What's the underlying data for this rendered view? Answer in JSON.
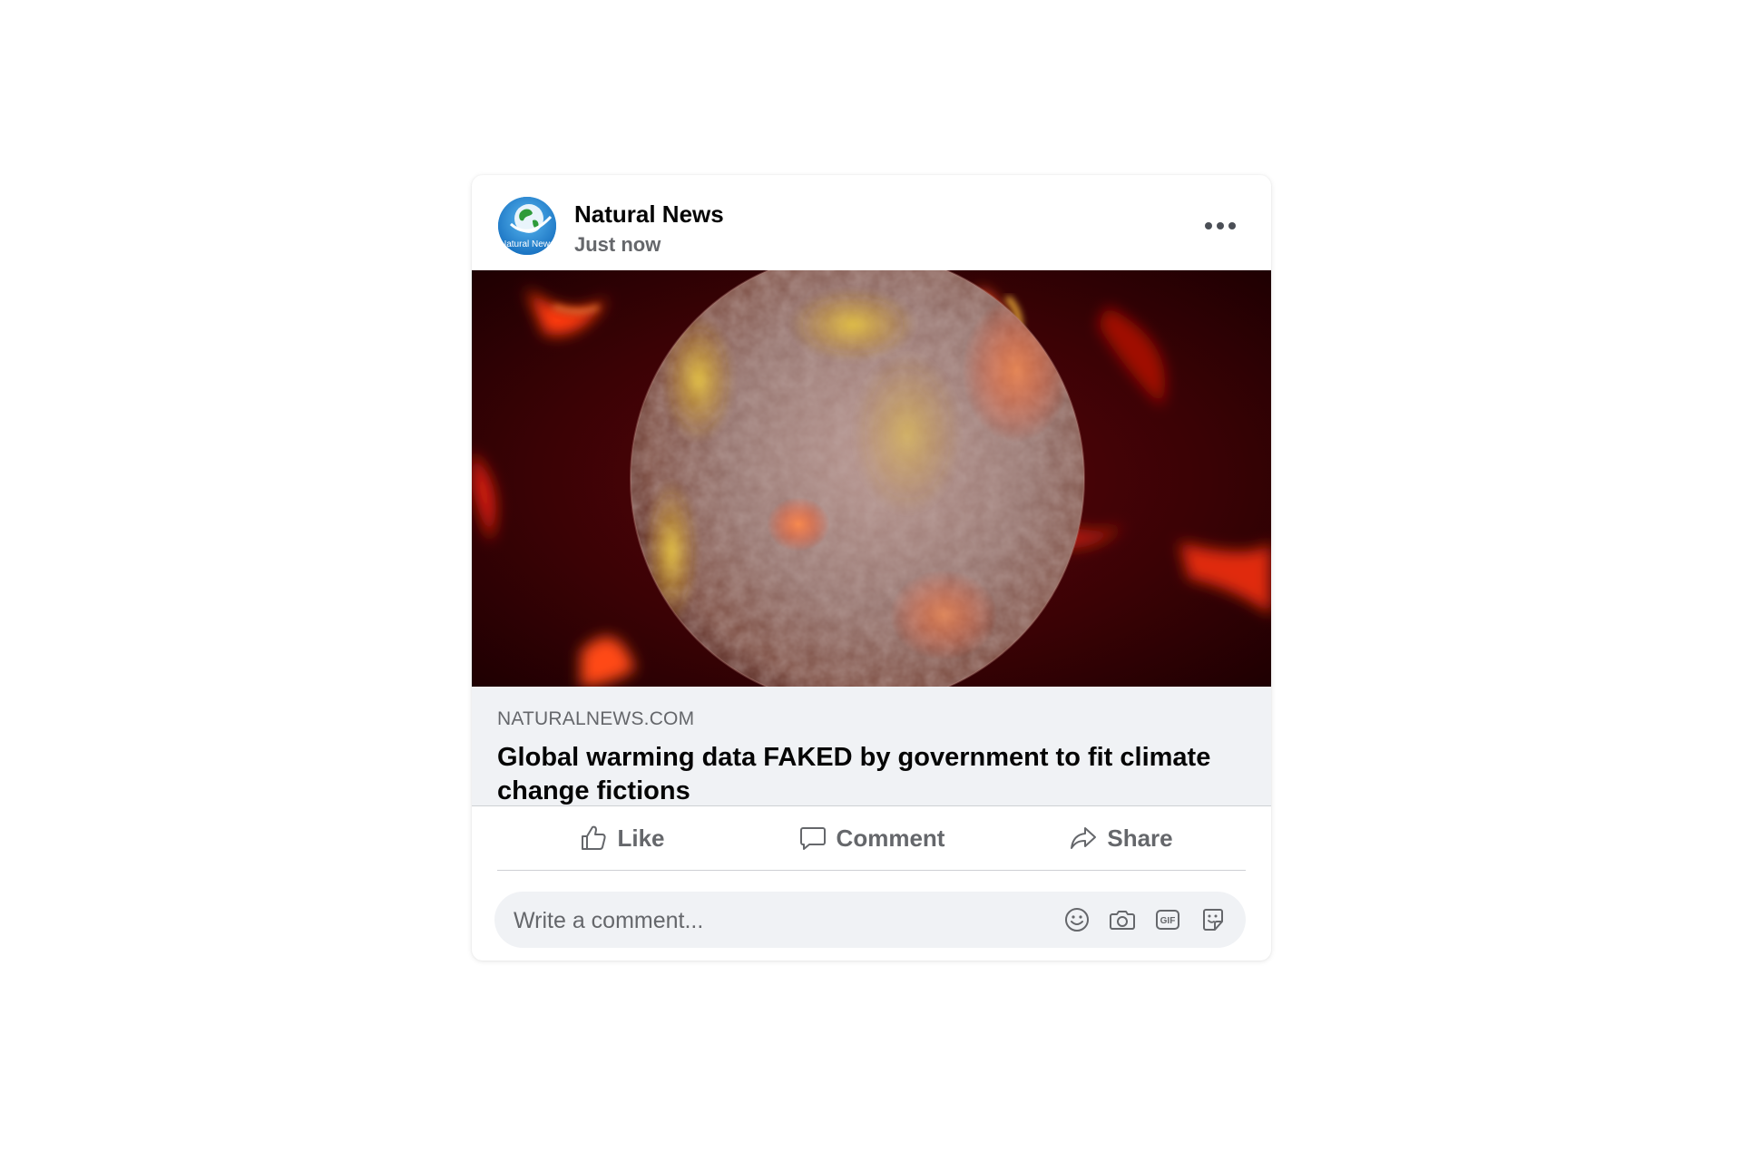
{
  "post": {
    "author": "Natural News",
    "time": "Just now",
    "avatar_text": "Natural News",
    "link": {
      "domain": "NATURALNEWS.COM",
      "title": "Global warming data FAKED by government to fit climate change fictions"
    },
    "image": {
      "subject": "planet-on-fire",
      "colors": {
        "background": "#3a0205",
        "fire": "#ff3b10",
        "glow": "#ffb020",
        "planet": "#9a7a74"
      }
    }
  },
  "actions": {
    "like": "Like",
    "comment": "Comment",
    "share": "Share"
  },
  "comment_box": {
    "placeholder": "Write a comment...",
    "icons": [
      "smiley-icon",
      "camera-icon",
      "gif-icon",
      "sticker-icon"
    ],
    "gif_label": "GIF"
  },
  "colors": {
    "text_primary": "#050505",
    "text_secondary": "#65676b",
    "surface": "#f0f2f5"
  }
}
